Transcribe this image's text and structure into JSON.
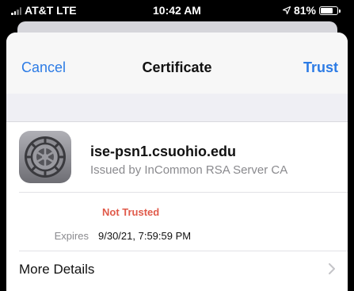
{
  "status_bar": {
    "carrier": "AT&T LTE",
    "time": "10:42 AM",
    "battery": "81%",
    "battery_level": 0.81,
    "signal_icon": "signal-bars-icon",
    "location_icon": "location-arrow-icon",
    "battery_icon": "battery-icon"
  },
  "nav": {
    "cancel_label": "Cancel",
    "title": "Certificate",
    "trust_label": "Trust"
  },
  "certificate": {
    "icon": "settings-gear-icon",
    "name": "ise-psn1.csuohio.edu",
    "issuer": "Issued by InCommon RSA Server CA",
    "trust_status": "Not Trusted",
    "expires_label": "Expires",
    "expires_value": "9/30/21, 7:59:59 PM"
  },
  "more_details": {
    "label": "More Details",
    "chevron_icon": "chevron-right-icon"
  },
  "colors": {
    "accent": "#2c7be5",
    "warning": "#e05a4a",
    "secondary_text": "#8a8a8e",
    "grouped_background": "#efeff4"
  }
}
